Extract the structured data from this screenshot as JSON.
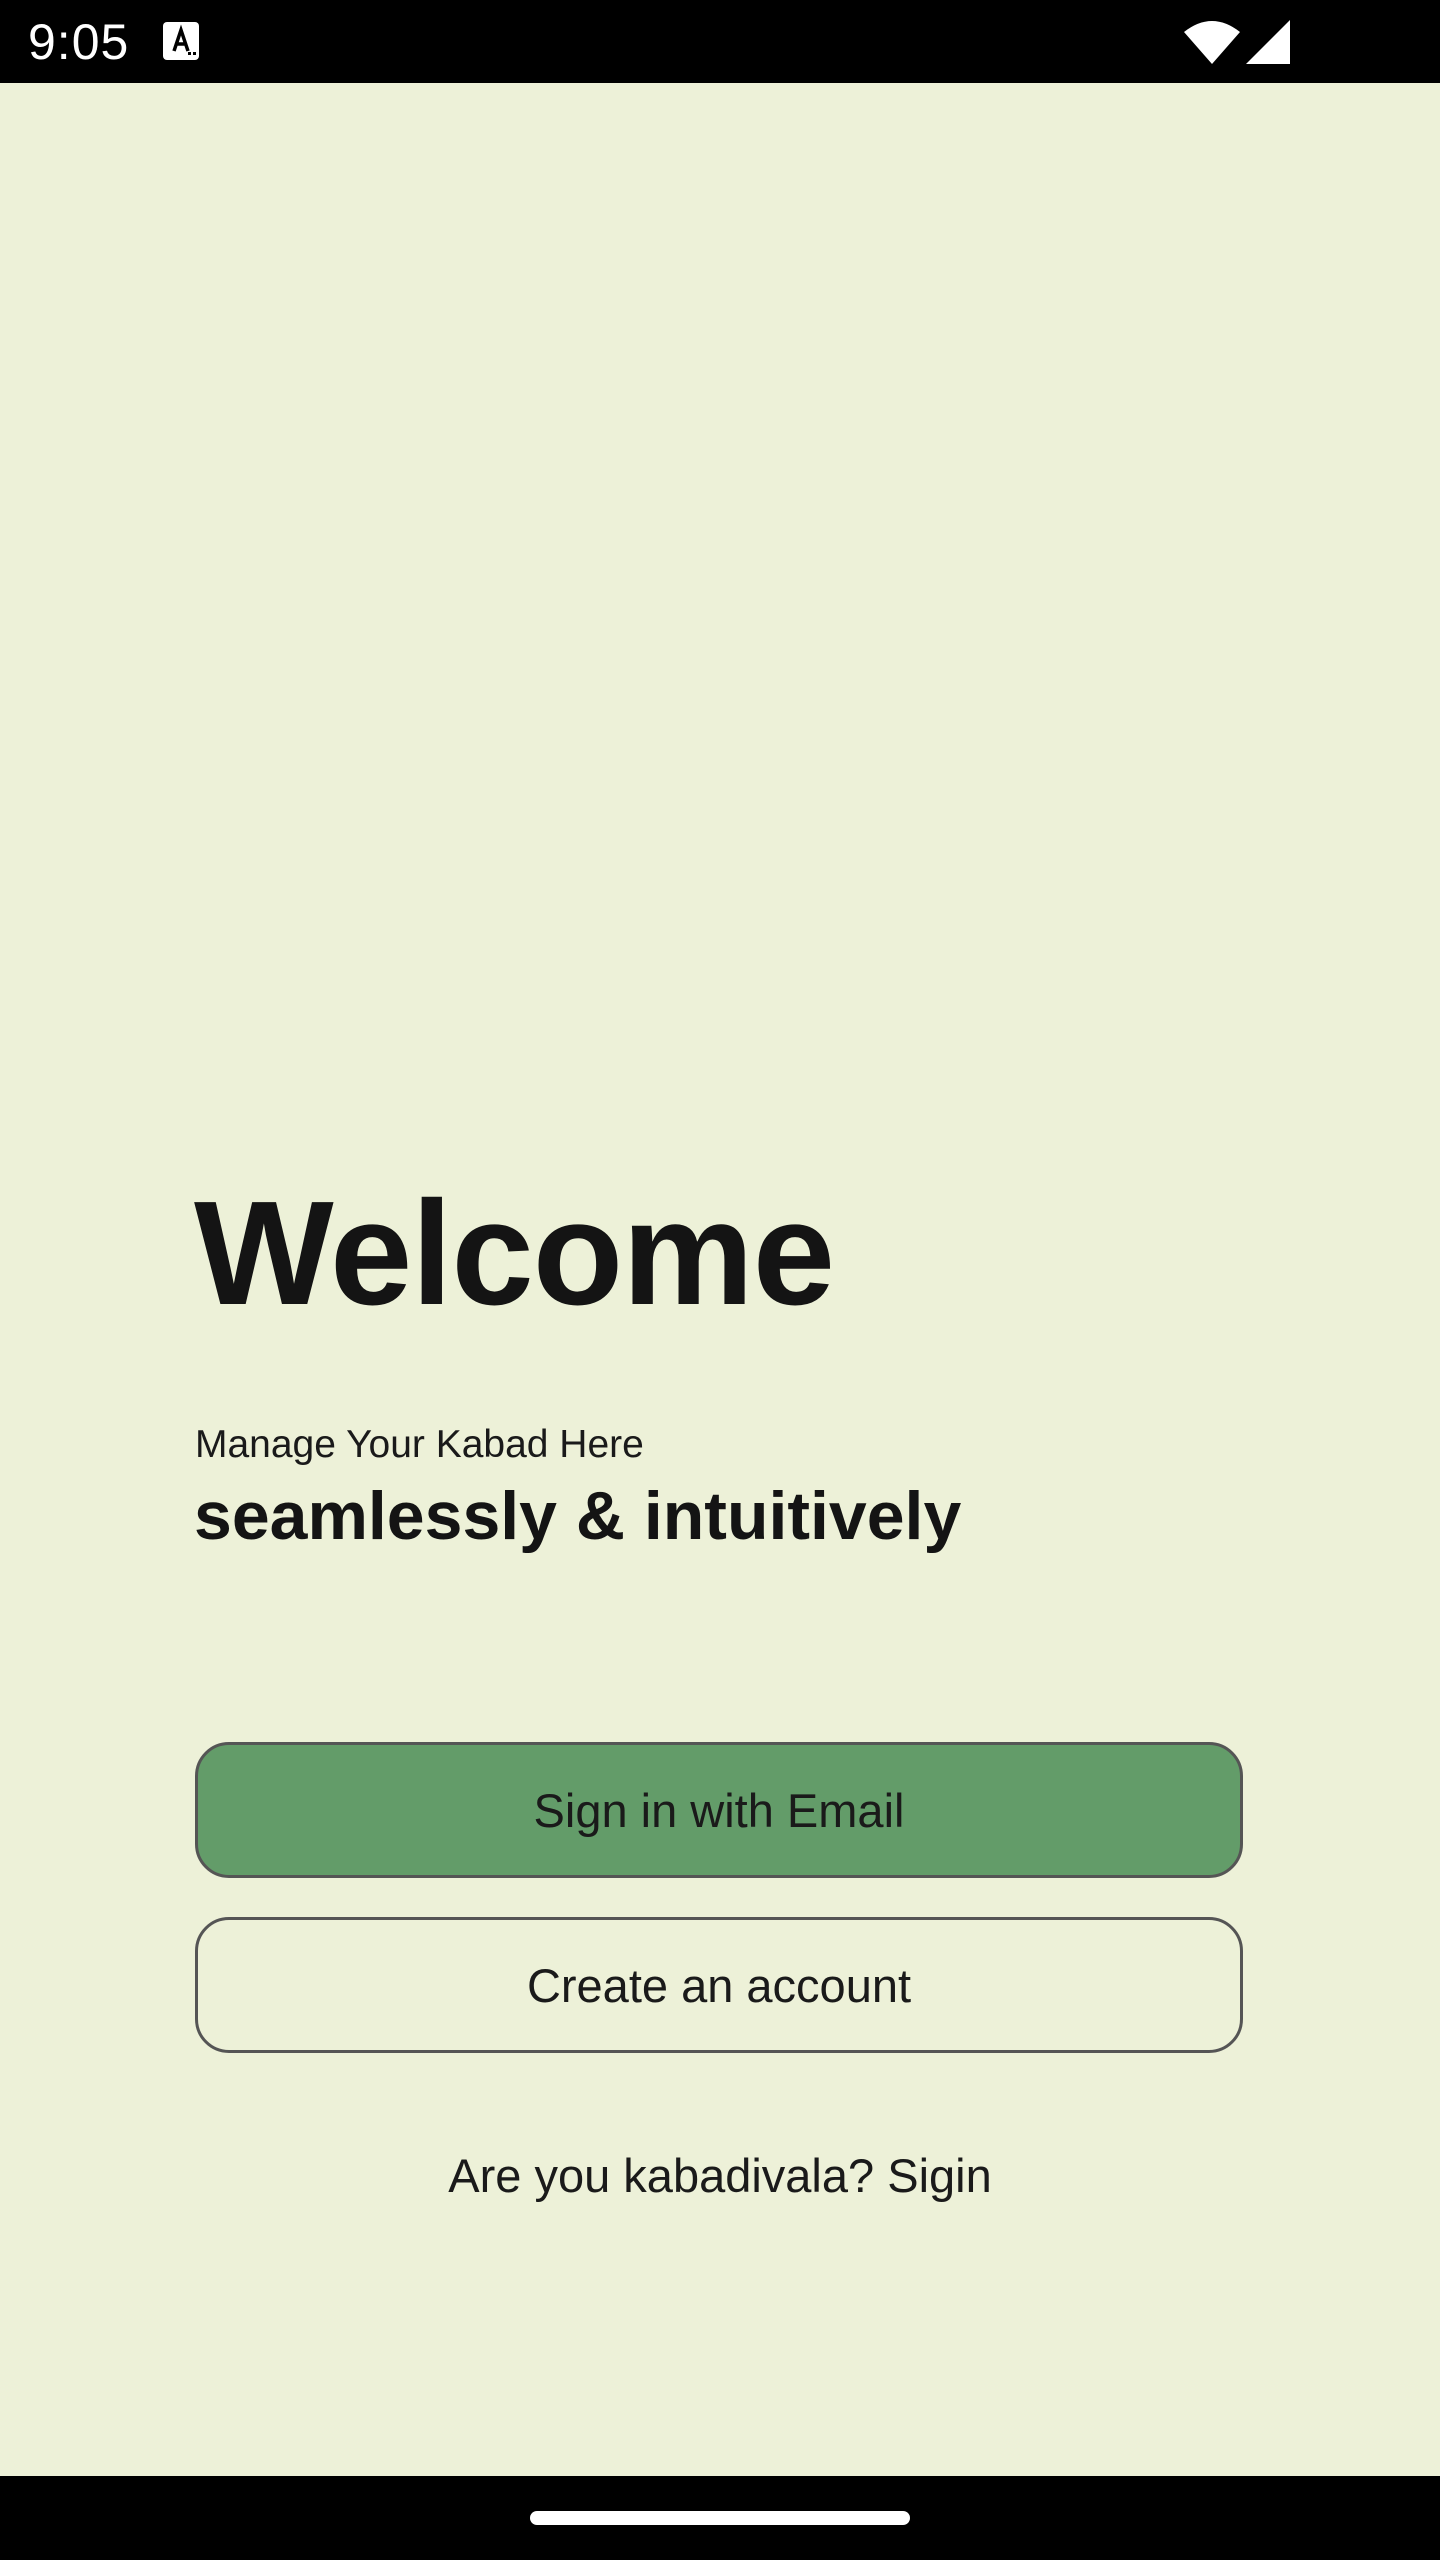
{
  "status_bar": {
    "time": "9:05",
    "icons": [
      "a-notification-icon",
      "wifi-icon",
      "signal-icon"
    ]
  },
  "welcome": {
    "title": "Welcome",
    "subtitle": "Manage Your Kabad Here",
    "tagline": "seamlessly & intuitively"
  },
  "actions": {
    "sign_in_label": "Sign in with Email",
    "create_account_label": "Create an account",
    "kabadivala_label": "Are you kabadivala? Sigin"
  },
  "colors": {
    "background": "#EDF1D8",
    "primary_button": "#639C69",
    "text": "#141414"
  }
}
